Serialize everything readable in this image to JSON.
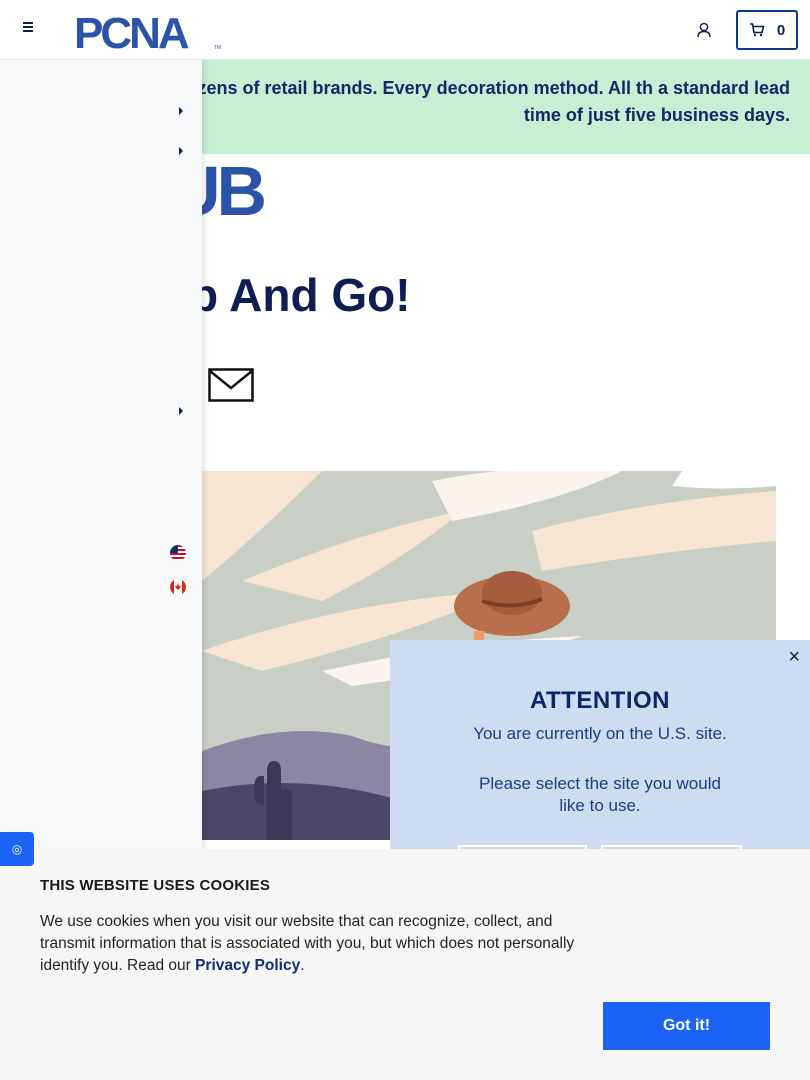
{
  "header": {
    "logo_text": "PCNA",
    "cart_count": "0"
  },
  "banner": {
    "text": "ls of products. Dozens of retail brands. Every decoration method. All th a standard lead time of just five business days."
  },
  "hero": {
    "hub_text": "UB",
    "title": "p And Go!"
  },
  "attention": {
    "close_label": "×",
    "title": "ATTENTION",
    "line1": "You are currently on the U.S. site.",
    "line2": "Please select the site you would like to use."
  },
  "cookie": {
    "title": "THIS WEBSITE USES COOKIES",
    "text_before": "We use cookies when you visit our website that can recognize, collect, and transmit information that is associated with you, but which does not personally identify you. Read our ",
    "link": "Privacy Policy",
    "text_after": ".",
    "button": "Got it!"
  },
  "colors": {
    "brand_navy": "#0b1f4d",
    "brand_blue": "#2b53a8",
    "banner_green": "#c6efd4",
    "modal_blue": "#cddcf0",
    "button_blue": "#1a63f5"
  },
  "icons": [
    "menu-icon",
    "user-icon",
    "cart-icon",
    "mail-icon",
    "chevron-right-icon",
    "us-flag-icon",
    "canada-flag-icon",
    "close-icon",
    "accessibility-icon"
  ]
}
